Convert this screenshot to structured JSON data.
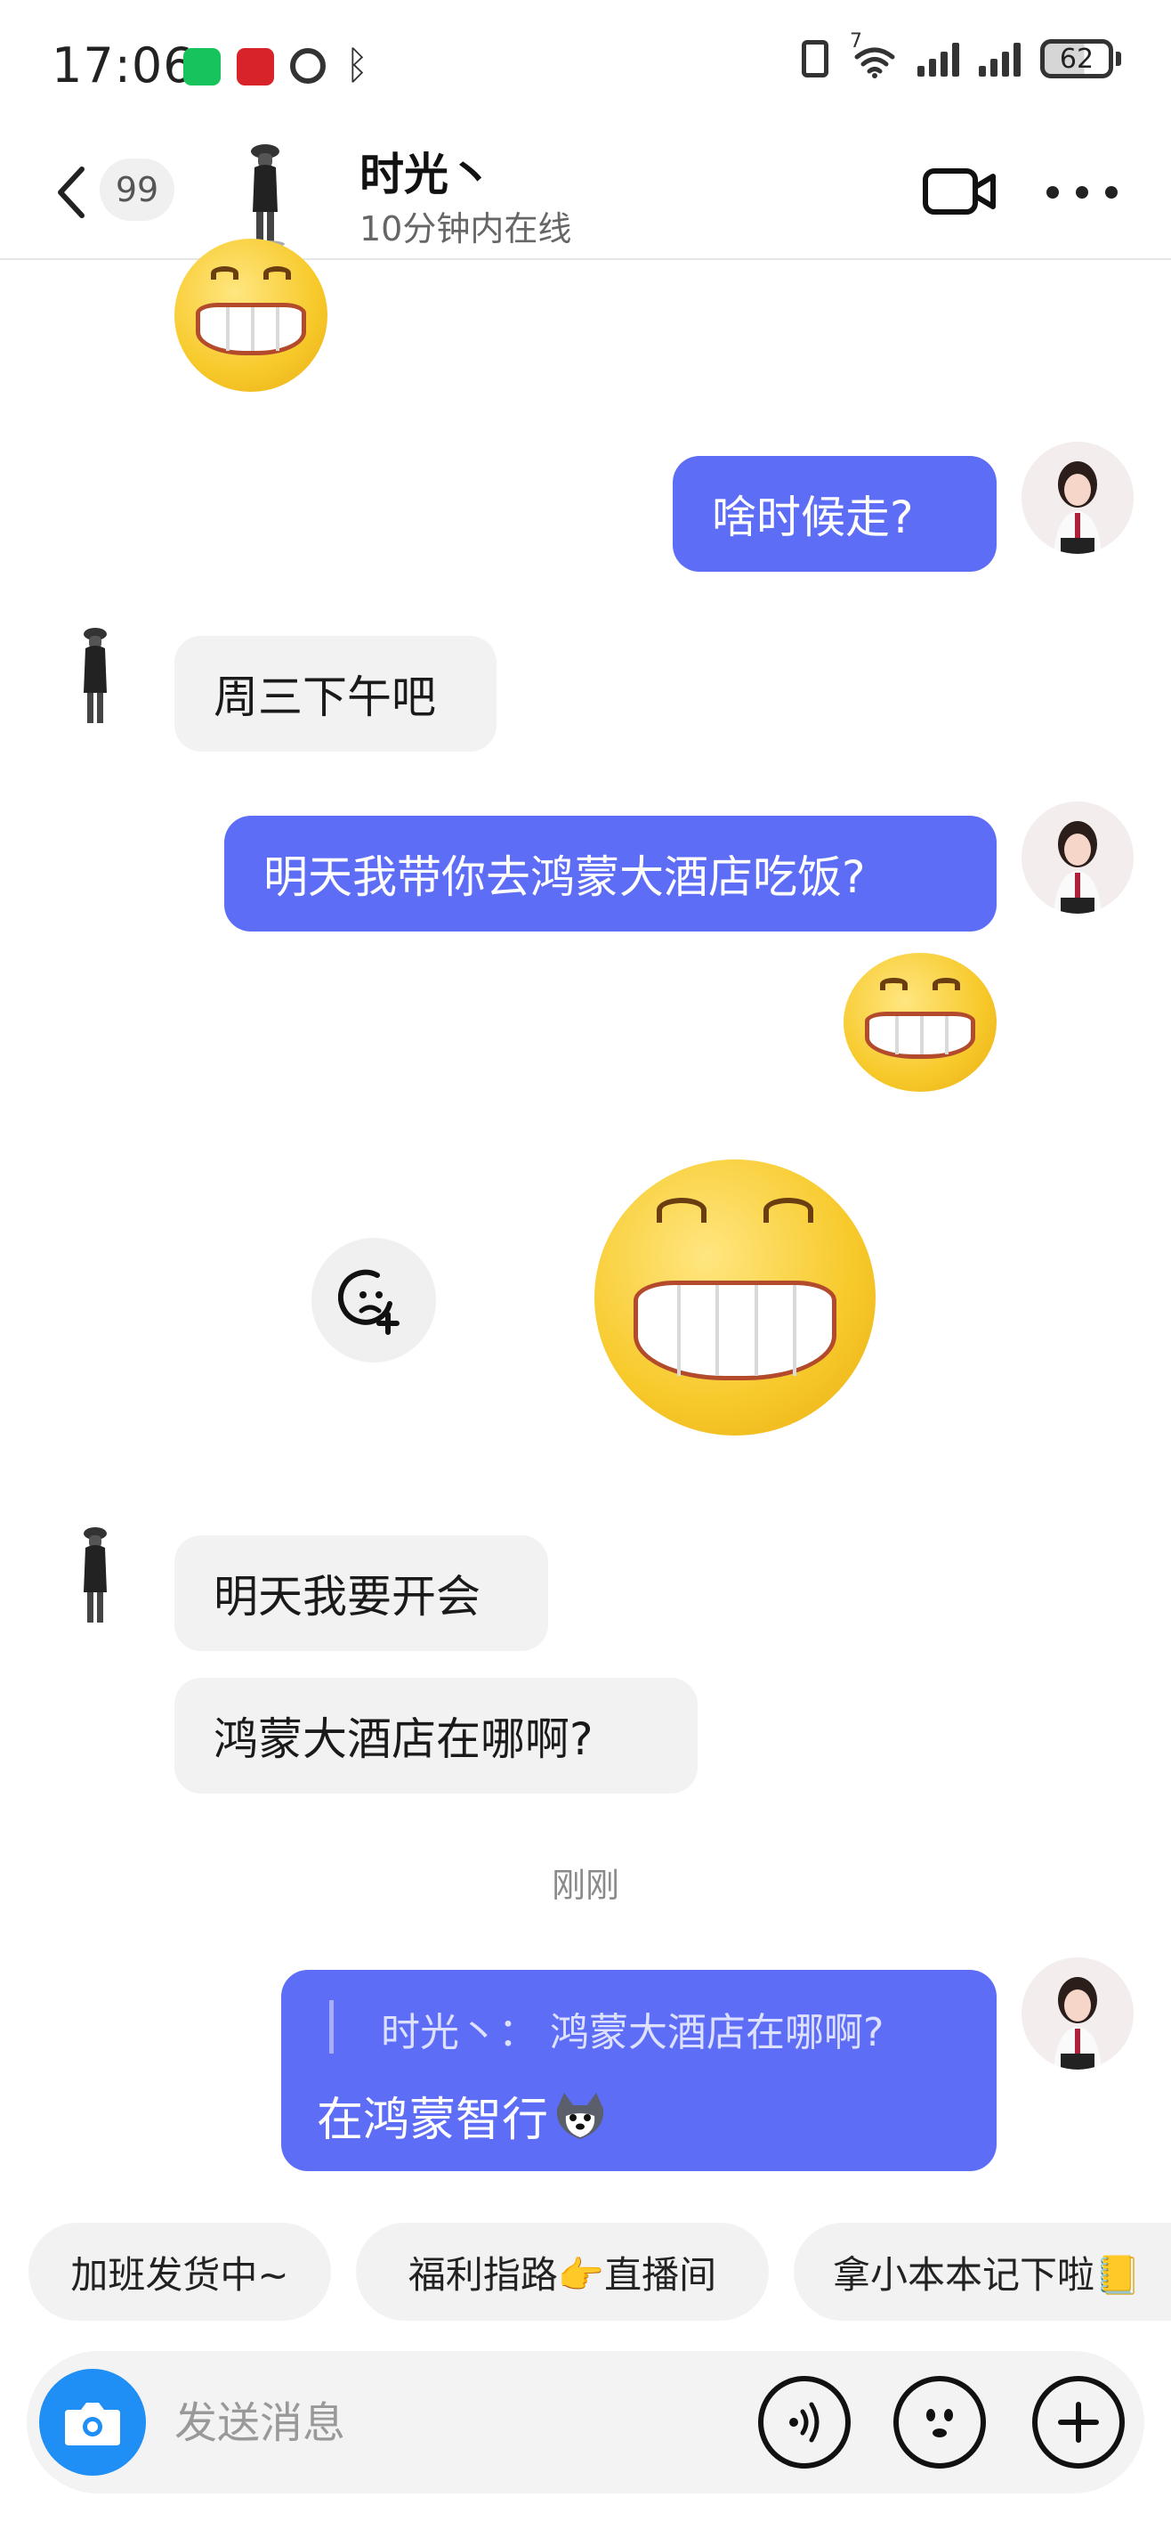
{
  "status_bar": {
    "time": "17:06",
    "network_badge": "7",
    "battery": "62",
    "icons": [
      "wechat-icon",
      "app-notification-icon",
      "alarm-icon",
      "bluetooth-icon",
      "vibrate-icon",
      "wifi-icon",
      "signal-icon",
      "signal-icon",
      "battery-icon"
    ]
  },
  "header": {
    "unread_count": "99",
    "contact_name": "时光丶",
    "online_status": "10分钟内在线",
    "icons": [
      "back-arrow-icon",
      "video-call-icon",
      "more-icon"
    ]
  },
  "messages": [
    {
      "side": "in",
      "type": "emoji",
      "emoji": "grin-small"
    },
    {
      "side": "out",
      "type": "text",
      "text": "啥时候走?"
    },
    {
      "side": "in",
      "type": "text",
      "text": "周三下午吧"
    },
    {
      "side": "out",
      "type": "text",
      "text": "明天我带你去鸿蒙大酒店吃饭?"
    },
    {
      "side": "out",
      "type": "emoji",
      "emoji": "grin-small"
    },
    {
      "side": "out",
      "type": "sticker",
      "emoji": "grin-big"
    },
    {
      "side": "in",
      "type": "text",
      "text": "明天我要开会"
    },
    {
      "side": "in",
      "type": "text",
      "text": "鸿蒙大酒店在哪啊?"
    }
  ],
  "timestamp": "刚刚",
  "reply": {
    "quoted": "时光丶：  鸿蒙大酒店在哪啊?",
    "text": "在鸿蒙智行",
    "trailing_emoji": "husky-icon"
  },
  "quick_replies": [
    "加班发货中~",
    "福利指路👉直播间",
    "拿小本本记下啦📒"
  ],
  "input": {
    "placeholder": "发送消息",
    "icons": [
      "camera-icon",
      "voice-icon",
      "emoji-icon",
      "plus-icon"
    ]
  },
  "colors": {
    "outgoing_bubble": "#5e6df5",
    "incoming_bubble": "#f2f2f2",
    "camera_button": "#1f8ff5"
  }
}
